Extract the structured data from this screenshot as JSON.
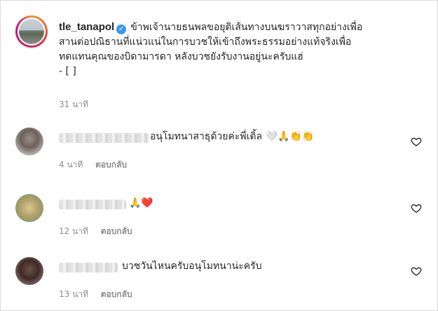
{
  "post": {
    "username": "tle_tanapol",
    "caption_line1": "ข้าพเจ้านายธนพลขอยุติเส้นทางบนฆราวาสทุกอย่างเพื่อ",
    "caption_line2": "สานต่อปณิธานที่แน่วแน่ในการบวชให้เข้าถึงพระธรรมอย่างแท้จริงเพื่อ",
    "caption_line3": "ทดแทนคุณของบิดามารดา หลังบวชยังรับงานอยู่นะครับแฮ่",
    "caption_line4": "- [ ]",
    "time": "31 นาที"
  },
  "comments": [
    {
      "text": "อนุโมทนาสาธุด้วยค่ะพี่เติ้ล",
      "emojis": "🤍🙏👏👏",
      "time": "4 นาที",
      "reply": "ตอบกลับ"
    },
    {
      "text": "",
      "emojis": "🙏❤️",
      "time": "12 นาที",
      "reply": "ตอบกลับ"
    },
    {
      "text": "บวชวันไหนครับอนุโมทนาน่ะครับ",
      "emojis": "",
      "time": "13 นาที",
      "reply": "ตอบกลับ"
    }
  ],
  "icons": {
    "verified": "verified-badge-icon",
    "like": "heart-outline-icon"
  },
  "colors": {
    "verified": "#3897f0",
    "muted": "#8e8e8e",
    "text": "#262626"
  }
}
